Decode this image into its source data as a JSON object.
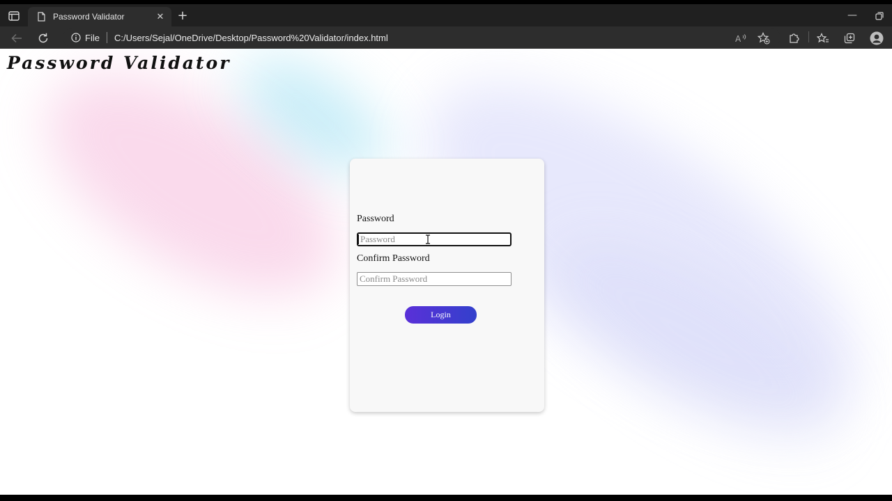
{
  "browser": {
    "tab": {
      "title": "Password Validator"
    },
    "address": {
      "scheme": "File",
      "url": "C:/Users/Sejal/OneDrive/Desktop/Password%20Validator/index.html"
    }
  },
  "page": {
    "site_title": "Password Validator",
    "form": {
      "password_label": "Password",
      "password_placeholder": "Password",
      "confirm_label": "Confirm Password",
      "confirm_placeholder": "Confirm Password",
      "login_label": "Login"
    }
  },
  "colors": {
    "login_gradient_start": "#5a30d8",
    "login_gradient_end": "#3340cc",
    "card_background": "#f8f8f8"
  },
  "icons": {
    "tab_actions": "tab-actions-icon",
    "page": "page-icon",
    "close": "close-icon",
    "new_tab": "plus-icon",
    "back": "back-arrow-icon",
    "refresh": "refresh-icon",
    "info": "info-icon",
    "read_aloud": "read-aloud-icon",
    "add_favorite": "star-plus-icon",
    "extensions": "puzzle-icon",
    "favorites": "favorites-icon",
    "collections": "collections-icon",
    "profile": "profile-avatar-icon",
    "minimize": "minimize-icon",
    "restore": "restore-icon",
    "text_cursor": "text-cursor-icon"
  }
}
